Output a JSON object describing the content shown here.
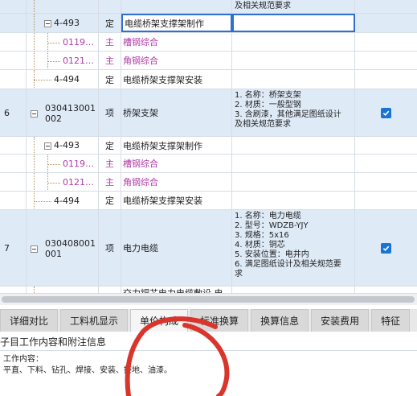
{
  "grid": {
    "rows": [
      {
        "id": "r0",
        "num": "",
        "code": "",
        "type": "",
        "name": "",
        "features": [
          "及相关规范要求"
        ],
        "checked": false,
        "kind": "top-tail"
      },
      {
        "id": "r1",
        "num": "",
        "code": "4-493",
        "type": "定",
        "name": "电缆桥架支撑架制作",
        "features": [],
        "checked": false,
        "kind": "sub-selected"
      },
      {
        "id": "r2",
        "num": "",
        "code": "0119…",
        "type": "主",
        "name": "槽钢综合",
        "features": [],
        "checked": false,
        "kind": "material"
      },
      {
        "id": "r3",
        "num": "",
        "code": "0121…",
        "type": "主",
        "name": "角钢综合",
        "features": [],
        "checked": false,
        "kind": "material"
      },
      {
        "id": "r4",
        "num": "",
        "code": "4-494",
        "type": "定",
        "name": "电缆桥架支撑架安装",
        "features": [],
        "checked": false,
        "kind": "sub"
      },
      {
        "id": "r5",
        "num": "6",
        "code": "030413001\n002",
        "type": "项",
        "name": "桥架支架",
        "features": [
          "1. 名称：桥架支架",
          "2. 材质：一般型钢",
          "3. 含刷漆，其他满足图纸设计",
          "及相关规范要求"
        ],
        "checked": true,
        "kind": "item"
      },
      {
        "id": "r6",
        "num": "",
        "code": "4-493",
        "type": "定",
        "name": "电缆桥架支撑架制作",
        "features": [],
        "checked": false,
        "kind": "sub"
      },
      {
        "id": "r7",
        "num": "",
        "code": "0119…",
        "type": "主",
        "name": "槽钢综合",
        "features": [],
        "checked": false,
        "kind": "material"
      },
      {
        "id": "r8",
        "num": "",
        "code": "0121…",
        "type": "主",
        "name": "角钢综合",
        "features": [],
        "checked": false,
        "kind": "material"
      },
      {
        "id": "r9",
        "num": "",
        "code": "4-494",
        "type": "定",
        "name": "电缆桥架支撑架安装",
        "features": [],
        "checked": false,
        "kind": "sub"
      },
      {
        "id": "r10",
        "num": "7",
        "code": "030408001\n001",
        "type": "项",
        "name": "电力电缆",
        "features": [
          "1. 名称：电力电缆",
          "2. 型号：WDZB-YJY",
          "3. 规格：5x16",
          "4. 材质：铜芯",
          "5. 安装位置：电井内",
          "6. 满足图纸设计及相关规范要",
          "求"
        ],
        "checked": true,
        "kind": "item"
      },
      {
        "id": "r11",
        "num": "",
        "code": "",
        "type": "",
        "name": "交力铜芯电力电缆敷设 电",
        "features": [],
        "checked": false,
        "kind": "cut"
      }
    ]
  },
  "tabs": [
    {
      "label": "详细对比",
      "active": false
    },
    {
      "label": "工料机显示",
      "active": false
    },
    {
      "label": "单价构成",
      "active": true
    },
    {
      "label": "标准换算",
      "active": false
    },
    {
      "label": "换算信息",
      "active": false
    },
    {
      "label": "安装费用",
      "active": false
    },
    {
      "label": "特征",
      "active": false
    }
  ],
  "panel": {
    "title": "子目工作内容和附注信息",
    "content_label": "工作内容：",
    "content_text": "平直、下料、钻孔、焊接、安装、接地、油漆。"
  },
  "colors": {
    "selection_border": "#2f6fd2",
    "item_row_bg": "#dfeaf7",
    "material_text": "#b03aa6",
    "checkbox": "#1a74d6",
    "annotation_stroke": "#d9352b"
  }
}
